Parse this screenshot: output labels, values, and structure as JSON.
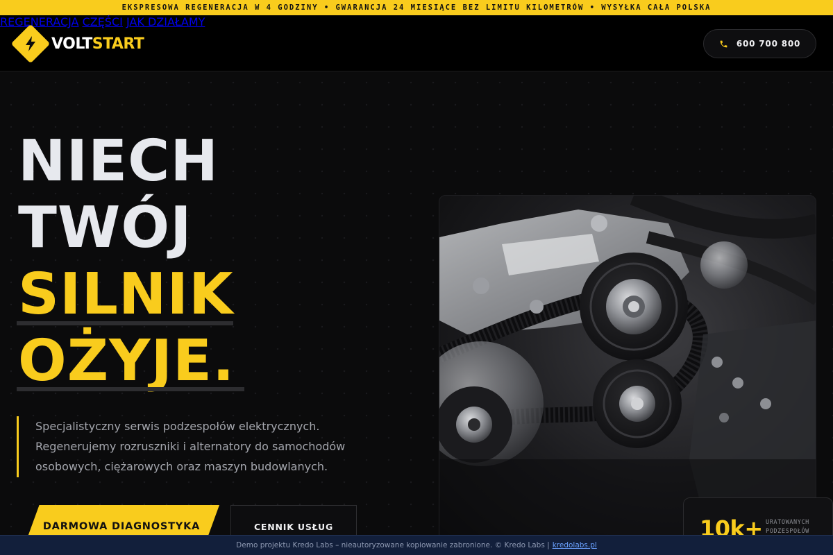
{
  "ticker": {
    "text": "EKSPRESOWA REGENERACJA W 4 GODZINY • GWARANCJA 24 MIESIĄCE BEZ LIMITU KILOMETRÓW • WYSYŁKA CAŁA POLSKA"
  },
  "brand": {
    "name_part1": "VOLT",
    "name_part2": "START",
    "accent": "#f9cc1d"
  },
  "nav": {
    "items": [
      {
        "label": "REGENERACJA"
      },
      {
        "label": "CZĘŚCI"
      },
      {
        "label": "JAK DZIAŁAMY"
      }
    ],
    "phone": "600 700 800",
    "phone_icon": "phone-icon"
  },
  "hero": {
    "lines": [
      "NIECH",
      "TWÓJ",
      "SILNIK",
      "OŻYJE."
    ],
    "lead": "Specjalistyczny serwis podzespołów elektrycznych. Regenerujemy rozruszniki i alternatory do samochodów osobowych, ciężarowych oraz maszyn budowlanych.",
    "cta_primary": "DARMOWA DIAGNOSTYKA",
    "cta_secondary": "CENNIK USŁUG"
  },
  "stat": {
    "value": "10k+",
    "label": "URATOWANYCH PODZESPOŁÓW"
  },
  "footer": {
    "text": "Demo projektu Kredo Labs – nieautoryzowane kopiowanie zabronione. © Kredo Labs |",
    "link": "kredolabs.pl"
  },
  "colors": {
    "background": "#0b0b0c",
    "accent": "#f9cc1d",
    "footer_bg": "#121f3b"
  }
}
